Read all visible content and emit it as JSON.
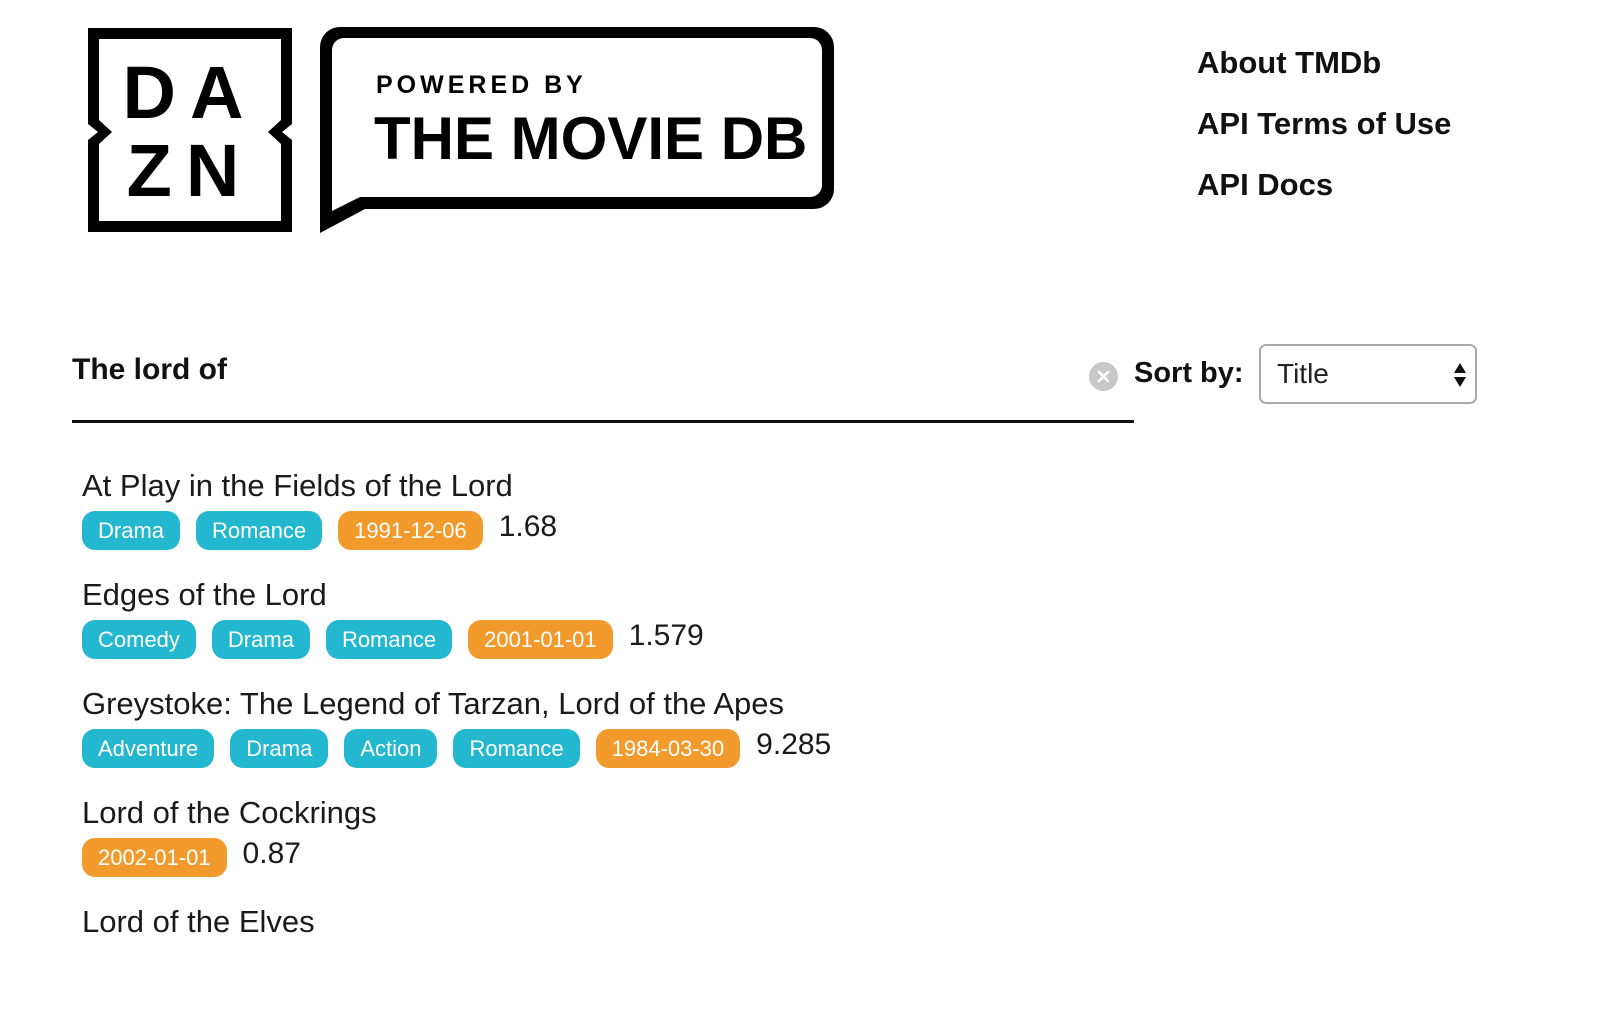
{
  "header": {
    "dazn_logo": {
      "row1": "DA",
      "row2": "ZN"
    },
    "tmdb_logo": {
      "line1": "POWERED BY",
      "line2": "THE MOVIE DB"
    },
    "nav": [
      {
        "label": "About TMDb"
      },
      {
        "label": "API Terms of Use"
      },
      {
        "label": "API Docs"
      }
    ]
  },
  "search": {
    "value": "The lord of",
    "placeholder": ""
  },
  "sort": {
    "label": "Sort by:",
    "selected": "Title"
  },
  "results": [
    {
      "title": "At Play in the Fields of the Lord",
      "genres": [
        "Drama",
        "Romance"
      ],
      "release_date": "1991-12-06",
      "score": "1.68"
    },
    {
      "title": "Edges of the Lord",
      "genres": [
        "Comedy",
        "Drama",
        "Romance"
      ],
      "release_date": "2001-01-01",
      "score": "1.579"
    },
    {
      "title": "Greystoke: The Legend of Tarzan, Lord of the Apes",
      "genres": [
        "Adventure",
        "Drama",
        "Action",
        "Romance"
      ],
      "release_date": "1984-03-30",
      "score": "9.285"
    },
    {
      "title": "Lord of the Cockrings",
      "genres": [],
      "release_date": "2002-01-01",
      "score": "0.87"
    },
    {
      "title": "Lord of the Elves",
      "genres": [],
      "release_date": "",
      "score": ""
    }
  ],
  "colors": {
    "genre_tag": "#23b8cf",
    "date_tag": "#f39a2c",
    "text": "#1a1a1a"
  }
}
